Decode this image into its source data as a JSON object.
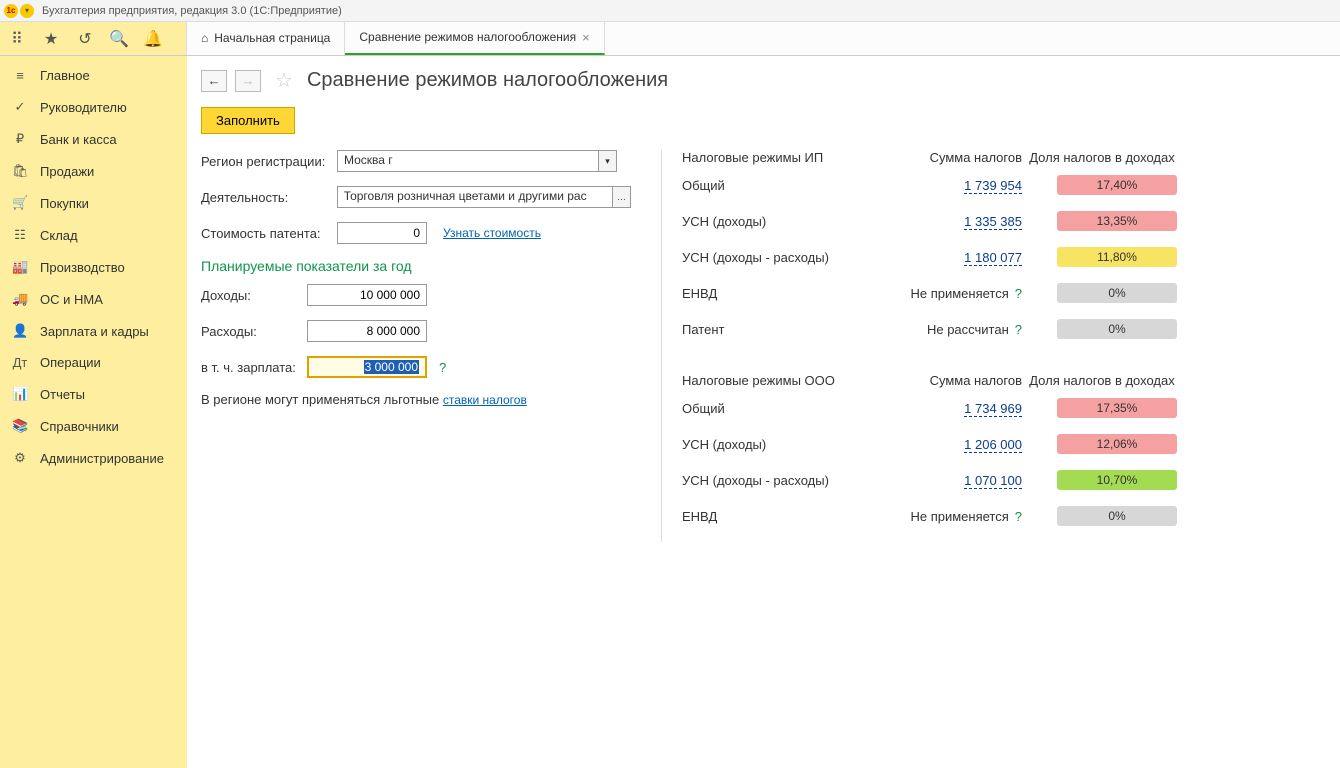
{
  "title": "Бухгалтерия предприятия, редакция 3.0  (1С:Предприятие)",
  "tabs": [
    {
      "label": "Начальная страница"
    },
    {
      "label": "Сравнение режимов налогообложения"
    }
  ],
  "sidebar": [
    {
      "icon": "≡",
      "label": "Главное"
    },
    {
      "icon": "✓",
      "label": "Руководителю"
    },
    {
      "icon": "₽",
      "label": "Банк и касса"
    },
    {
      "icon": "🛍",
      "label": "Продажи"
    },
    {
      "icon": "🛒",
      "label": "Покупки"
    },
    {
      "icon": "☷",
      "label": "Склад"
    },
    {
      "icon": "🏭",
      "label": "Производство"
    },
    {
      "icon": "🚚",
      "label": "ОС и НМА"
    },
    {
      "icon": "👤",
      "label": "Зарплата и кадры"
    },
    {
      "icon": "Дт",
      "label": "Операции"
    },
    {
      "icon": "📊",
      "label": "Отчеты"
    },
    {
      "icon": "📚",
      "label": "Справочники"
    },
    {
      "icon": "⚙",
      "label": "Администрирование"
    }
  ],
  "page": {
    "title": "Сравнение режимов налогообложения",
    "fill_btn": "Заполнить",
    "region_label": "Регион регистрации:",
    "region_value": "Москва г",
    "activity_label": "Деятельность:",
    "activity_value": "Торговля розничная цветами и другими рас",
    "patent_label": "Стоимость патента:",
    "patent_value": "0",
    "patent_link": "Узнать стоимость",
    "plan_header": "Планируемые показатели за год",
    "income_label": "Доходы:",
    "income_value": "10 000 000",
    "expense_label": "Расходы:",
    "expense_value": "8 000 000",
    "salary_label": "в т. ч. зарплата:",
    "salary_value": "3 000 000",
    "note_prefix": "В регионе могут применяться льготные ",
    "note_link": "ставки налогов"
  },
  "right": {
    "ip_header": "Налоговые режимы ИП",
    "sum_header": "Сумма налогов",
    "share_header": "Доля налогов в доходах",
    "ooo_header": "Налоговые режимы ООО",
    "ip": [
      {
        "name": "Общий",
        "amount": "1 739 954",
        "share": "17,40%",
        "cls": "red"
      },
      {
        "name": "УСН (доходы)",
        "amount": "1 335 385",
        "share": "13,35%",
        "cls": "red"
      },
      {
        "name": "УСН (доходы - расходы)",
        "amount": "1 180 077",
        "share": "11,80%",
        "cls": "yellow"
      },
      {
        "name": "ЕНВД",
        "na": "Не применяется",
        "share": "0%",
        "cls": "gray"
      },
      {
        "name": "Патент",
        "na": "Не рассчитан",
        "share": "0%",
        "cls": "gray"
      }
    ],
    "ooo": [
      {
        "name": "Общий",
        "amount": "1 734 969",
        "share": "17,35%",
        "cls": "red"
      },
      {
        "name": "УСН (доходы)",
        "amount": "1 206 000",
        "share": "12,06%",
        "cls": "red"
      },
      {
        "name": "УСН (доходы - расходы)",
        "amount": "1 070 100",
        "share": "10,70%",
        "cls": "green"
      },
      {
        "name": "ЕНВД",
        "na": "Не применяется",
        "share": "0%",
        "cls": "gray"
      }
    ]
  }
}
